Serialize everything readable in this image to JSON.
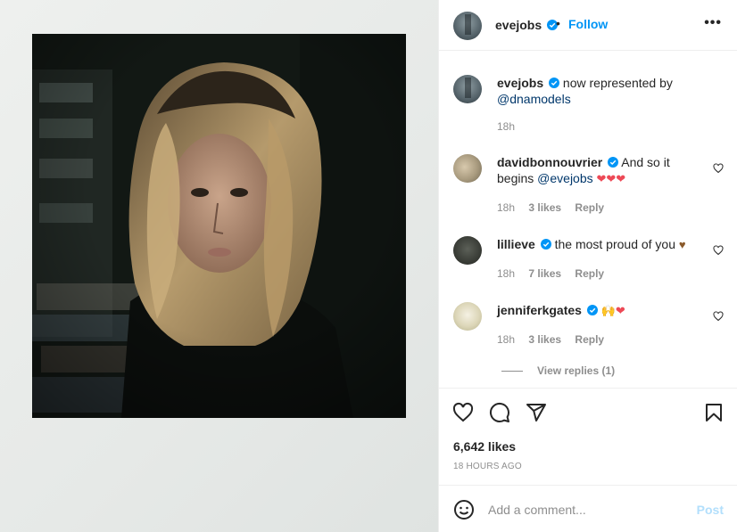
{
  "post": {
    "author": "evejobs",
    "follow_label": "Follow",
    "more_label": "•••",
    "caption": {
      "username": "evejobs",
      "text": "now represented by",
      "mention": "@dnamodels",
      "time": "18h"
    }
  },
  "comments": [
    {
      "username": "davidbonnouvrier",
      "text": "And so it begins",
      "mention": "@evejobs",
      "emoji": "❤❤❤",
      "time": "18h",
      "likes": "3 likes",
      "reply": "Reply"
    },
    {
      "username": "lillieve",
      "text": "the most proud of you",
      "emoji": "♥",
      "time": "18h",
      "likes": "7 likes",
      "reply": "Reply"
    },
    {
      "username": "jenniferkgates",
      "text": "",
      "emoji_hands": "🙌",
      "emoji": "❤",
      "time": "18h",
      "likes": "3 likes",
      "reply": "Reply"
    }
  ],
  "view_replies": "View replies (1)",
  "actions": {
    "icons": [
      "heart-icon",
      "comment-icon",
      "share-icon",
      "bookmark-icon"
    ],
    "likes": "6,642 likes",
    "ago": "18 HOURS AGO"
  },
  "composer": {
    "placeholder": "Add a comment...",
    "post_label": "Post"
  },
  "colors": {
    "accent": "#0095f6",
    "mention": "#00376b",
    "heart_red": "#ed4956",
    "muted": "#8e8e8e"
  }
}
